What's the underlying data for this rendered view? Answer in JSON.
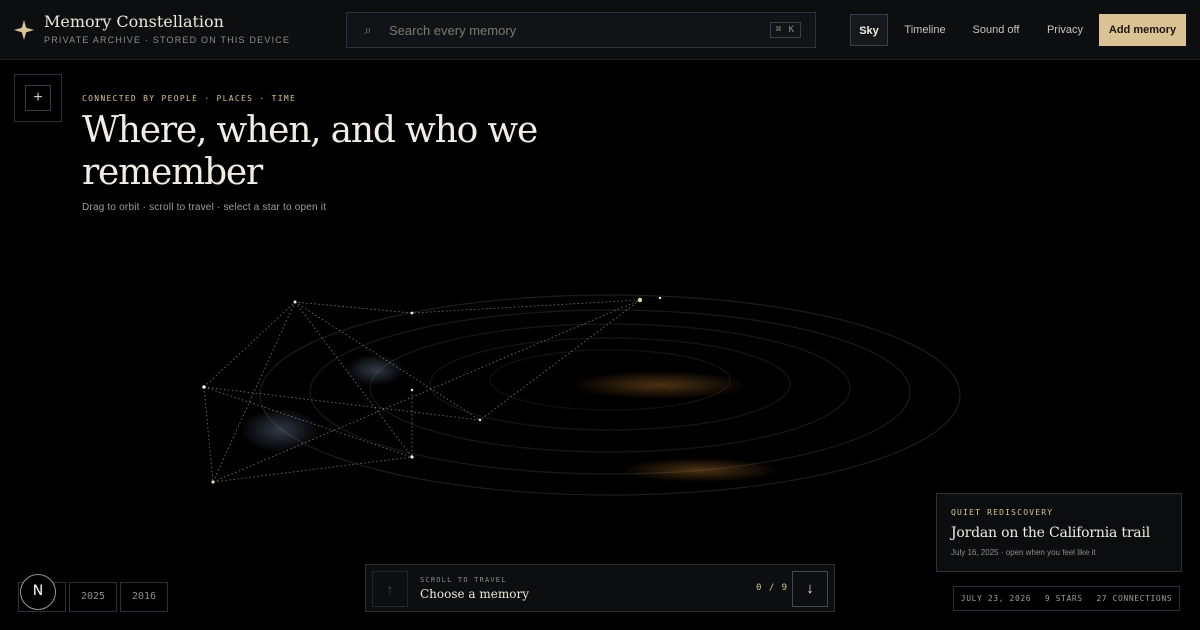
{
  "header": {
    "title": "Memory Constellation",
    "subtitle": "PRIVATE ARCHIVE · STORED ON THIS DEVICE",
    "search_placeholder": "Search every memory",
    "search_shortcut": "⌘ K",
    "nav": {
      "sky": "Sky",
      "timeline": "Timeline",
      "sound": "Sound off",
      "privacy": "Privacy",
      "add": "Add memory"
    }
  },
  "hero": {
    "eyebrow": "CONNECTED BY PEOPLE · PLACES · TIME",
    "title": "Where, when, and who we remember",
    "hint": "Drag to orbit · scroll to travel · select a star to open it"
  },
  "years": [
    "2025",
    "2016"
  ],
  "scroll": {
    "label": "SCROLL TO TRAVEL",
    "title": "Choose a memory",
    "count": "0 / 9"
  },
  "card": {
    "eyebrow": "QUIET REDISCOVERY",
    "title": "Jordan on the California trail",
    "meta": "July 16, 2025 · open when you feel like it"
  },
  "status": {
    "date": "JULY 23, 2026",
    "stars": "9 STARS",
    "connections": "27 CONNECTIONS"
  },
  "colors": {
    "accent": "#d9c293",
    "background": "#000000",
    "panel": "#0d0e10"
  },
  "icons": {
    "brand": "four-point-star-icon",
    "search": "search-icon",
    "plus": "plus-icon",
    "up": "arrow-up-icon",
    "down": "arrow-down-icon",
    "logo": "n-logo"
  }
}
